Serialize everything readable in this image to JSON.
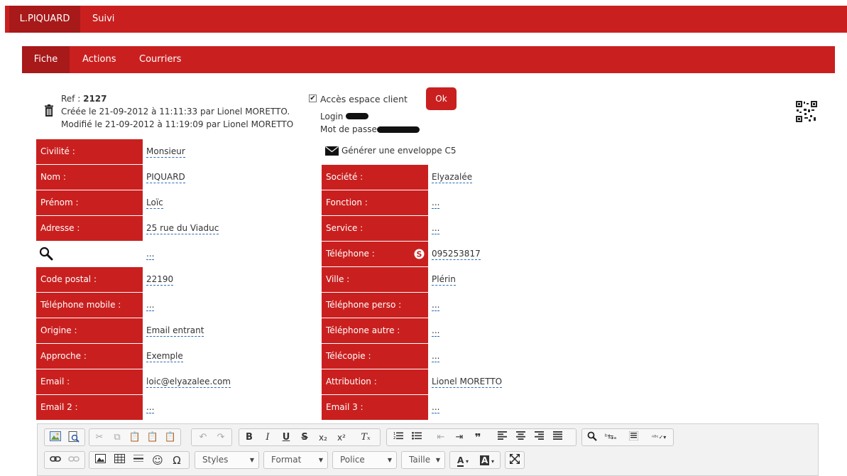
{
  "topnav": {
    "user": "L.PIQUARD",
    "suivi": "Suivi"
  },
  "subnav": {
    "fiche": "Fiche",
    "actions": "Actions",
    "courriers": "Courriers"
  },
  "record": {
    "ref_label": "Ref :",
    "ref_value": "2127",
    "created": "Créée le 21-09-2012 à 11:11:33 par Lionel MORETTO.",
    "modified": "Modifié le 21-09-2012 à 11:19:09 par Lionel MORETTO"
  },
  "access": {
    "label": "Accès espace client",
    "ok": "Ok",
    "login_label": "Login",
    "password_label": "Mot de passe"
  },
  "envelope": {
    "label": "Générer une enveloppe C5"
  },
  "left_fields": [
    {
      "label": "Civilité :",
      "value": "Monsieur"
    },
    {
      "label": "Nom :",
      "value": "PIQUARD"
    },
    {
      "label": "Prénom :",
      "value": "Loïc"
    },
    {
      "label": "Adresse :",
      "value": "25 rue du Viaduc"
    },
    {
      "label": "",
      "value": "..."
    },
    {
      "label": "Code postal :",
      "value": "22190"
    },
    {
      "label": "Téléphone mobile :",
      "value": "..."
    },
    {
      "label": "Origine :",
      "value": "Email entrant"
    },
    {
      "label": "Approche :",
      "value": "Exemple"
    },
    {
      "label": "Email :",
      "value": "loic@elyazalee.com"
    },
    {
      "label": "Email 2 :",
      "value": "..."
    }
  ],
  "right_fields": [
    {
      "label": "Société :",
      "value": "Elyazalée"
    },
    {
      "label": "Fonction :",
      "value": "..."
    },
    {
      "label": "Service :",
      "value": "..."
    },
    {
      "label": "Téléphone :",
      "value": "095253817"
    },
    {
      "label": "Ville :",
      "value": "Plérin"
    },
    {
      "label": "Téléphone perso :",
      "value": "..."
    },
    {
      "label": "Téléphone autre :",
      "value": "..."
    },
    {
      "label": "Télécopie :",
      "value": "..."
    },
    {
      "label": "Attribution :",
      "value": "Lionel MORETTO"
    },
    {
      "label": "Email 3 :",
      "value": "..."
    }
  ],
  "editor": {
    "styles": "Styles",
    "format": "Format",
    "police": "Police",
    "taille": "Taille",
    "b": "B",
    "i": "I",
    "u": "U",
    "s": "S",
    "sub": "x₂",
    "sup": "x²",
    "clear": "Tₓ",
    "quote": "❞",
    "omega": "Ω"
  }
}
